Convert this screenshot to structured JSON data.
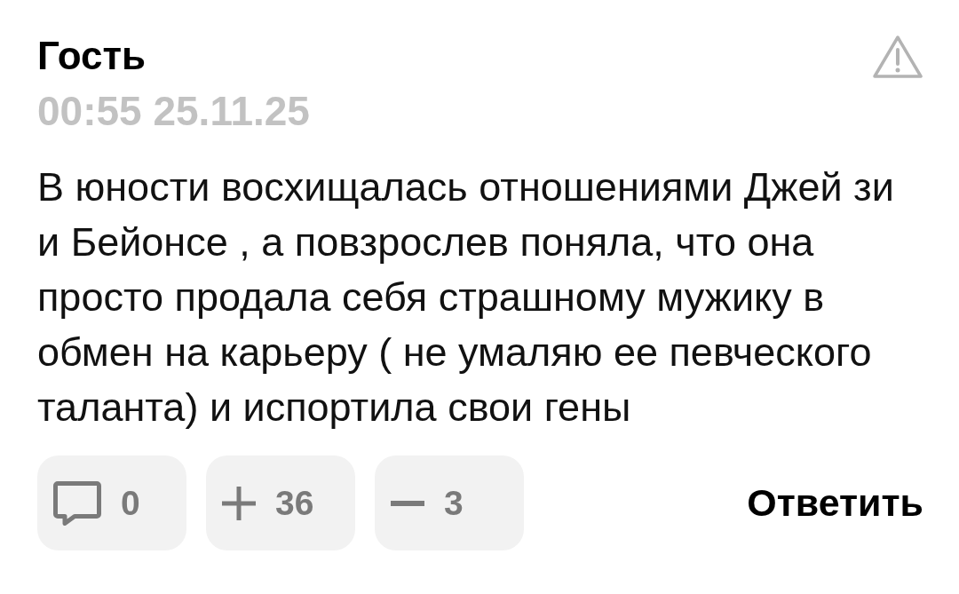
{
  "comment": {
    "author": "Гость",
    "timestamp": "00:55 25.11.25",
    "text": "В юности восхищалась отношениями Джей зи и Бейонсе , а повзрослев поняла, что она просто продала себя страшному мужику в обмен на карьеру ( не умаляю ее певческого таланта) и испортила свои гены"
  },
  "actions": [
    {
      "kind": "replies",
      "count": "0"
    },
    {
      "kind": "upvote",
      "count": "36"
    },
    {
      "kind": "downvote",
      "count": "3"
    }
  ],
  "reply_button": "Ответить"
}
